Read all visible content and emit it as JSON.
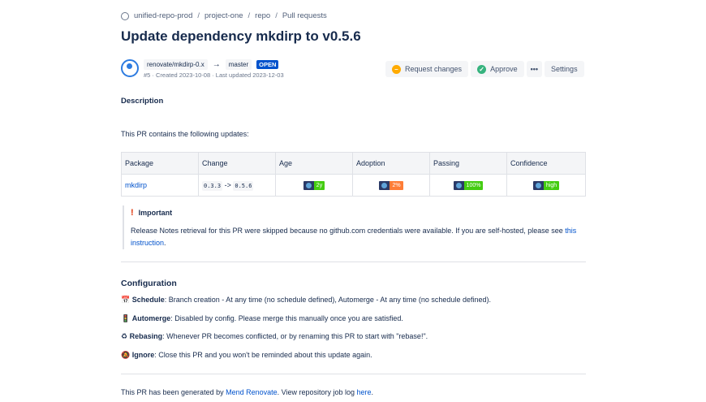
{
  "breadcrumb": [
    "unified-repo-prod",
    "project-one",
    "repo",
    "Pull requests"
  ],
  "title": "Update dependency mkdirp to v0.5.6",
  "pr": {
    "source_branch": "renovate/mkdirp-0.x",
    "target_branch": "master",
    "status": "OPEN",
    "meta": "#5 · Created 2023-10-08 · Last updated 2023-12-03"
  },
  "actions": {
    "request_changes": "Request changes",
    "approve": "Approve",
    "more": "•••",
    "settings": "Settings"
  },
  "description": {
    "heading": "Description",
    "intro": "This PR contains the following updates:"
  },
  "table": {
    "headers": [
      "Package",
      "Change",
      "Age",
      "Adoption",
      "Passing",
      "Confidence"
    ],
    "row": {
      "package": "mkdirp",
      "from": "0.3.3",
      "arrow": "->",
      "to": "0.5.6",
      "age": "2y",
      "adoption": "2%",
      "passing": "100%",
      "confidence": "high"
    },
    "colors": {
      "age": "#44cc11",
      "adoption": "#fe7d37",
      "passing": "#44cc11",
      "confidence": "#44cc11"
    }
  },
  "important": {
    "title": "Important",
    "text": "Release Notes retrieval for this PR were skipped because no github.com credentials were available. If you are self-hosted, please see ",
    "link": "this instruction",
    "end": "."
  },
  "configuration": {
    "heading": "Configuration",
    "items": [
      {
        "icon": "📅",
        "label": "Schedule",
        "text": ": Branch creation - At any time (no schedule defined), Automerge - At any time (no schedule defined)."
      },
      {
        "icon": "🚦",
        "label": "Automerge",
        "text": ": Disabled by config. Please merge this manually once you are satisfied."
      },
      {
        "icon": "♻",
        "label": "Rebasing",
        "text": ": Whenever PR becomes conflicted, or by renaming this PR to start with \"rebase!\"."
      },
      {
        "icon": "🔕",
        "label": "Ignore",
        "text": ": Close this PR and you won't be reminded about this update again."
      }
    ]
  },
  "footer": {
    "pre": "This PR has been generated by ",
    "link1": "Mend Renovate",
    "mid": ". View repository job log ",
    "link2": "here",
    "end": "."
  }
}
